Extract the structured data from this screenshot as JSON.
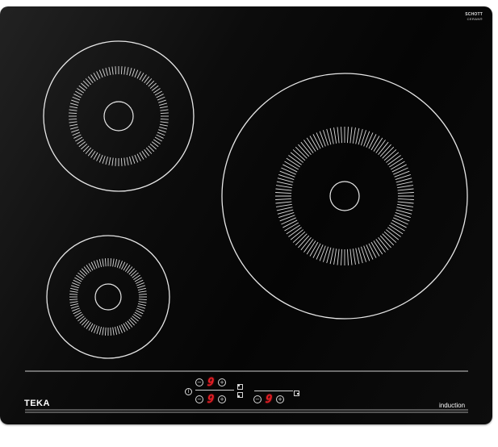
{
  "brand": {
    "name": "TEKA"
  },
  "glass_brand": {
    "line1": "SCHOTT",
    "line2": "CERAN®"
  },
  "technology_label": "induction",
  "zones": [
    {
      "name": "rear-left",
      "power_level": "9"
    },
    {
      "name": "front-left",
      "power_level": "9"
    },
    {
      "name": "right",
      "power_level": "9"
    }
  ],
  "controls": {
    "minus_symbol": "−",
    "plus_symbol": "+",
    "power_symbol": "ⓘ"
  },
  "colors": {
    "glass": "#0a0a0a",
    "markings": "#e6e6e6",
    "display": "#e51e25"
  }
}
